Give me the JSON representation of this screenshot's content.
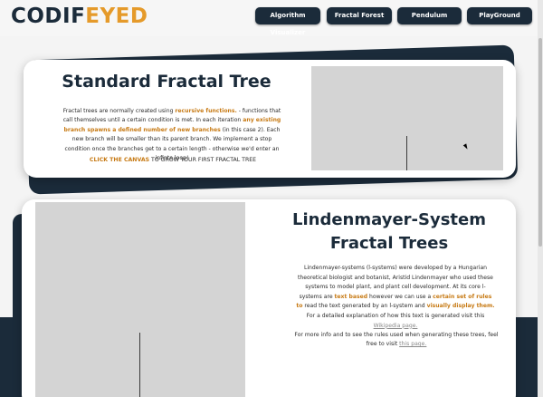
{
  "header": {
    "logo_part1": "CODIF",
    "logo_part2": "EYED",
    "nav": [
      {
        "label": "Algorithm Visualizer"
      },
      {
        "label": "Fractal Forest"
      },
      {
        "label": "Pendulum"
      },
      {
        "label": "PlayGround"
      }
    ]
  },
  "standard": {
    "title": "Standard Fractal Tree",
    "p1": "Fractal trees are normally created using ",
    "h1": "recursive functions.",
    "p2": " - functions that call themselves until a certain condition is met. In each iteration ",
    "h2": "any existing branch spawns a defined number of new branches",
    "p3": " (in this case 2). Each new branch will be smaller than its parent branch. We implement a stop condition once the branches get to a certain length - otherwise we'd enter an infinte loop!",
    "cta_highlight": "CLICK THE CANVAS",
    "cta_rest": " TO GROW YOUR FIRST FRACTAL TREE"
  },
  "lsystem": {
    "title_line1": "Lindenmayer-System",
    "title_line2": "Fractal Trees",
    "p1": "Lindenmayer-systems (l-systems) were developed by a Hungarian theoretical biologist and botanist, Aristid Lindenmayer who used these systems to model plant, and plant cell development. At its core l-systems are ",
    "h1": "text based",
    "p2": " however we can use a ",
    "h2": "certain set of rules to",
    "p3": " read the text generated by an l-system and ",
    "h3": "visually display them.",
    "p4": " For a detailed explanation of how this text is generated visit this ",
    "link1": "Wikipedia page.",
    "p5": "For more info and to see the rules used when generating these trees, feel free to visit ",
    "link2": "this page."
  },
  "colors": {
    "navy": "#1b2b3a",
    "accent": "#e59a2a",
    "highlight": "#c77a14",
    "canvas": "#d4d4d4"
  }
}
